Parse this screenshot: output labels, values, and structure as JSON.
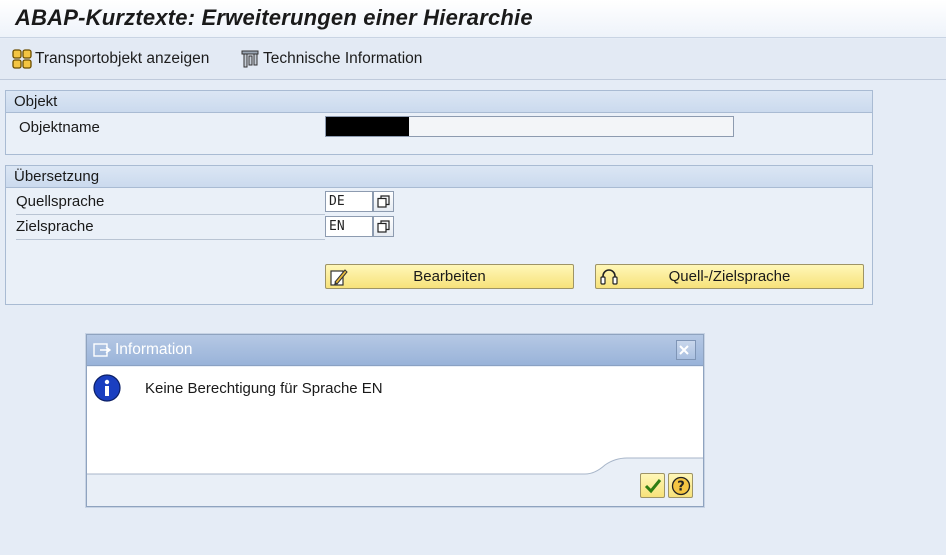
{
  "window": {
    "title": "ABAP-Kurztexte: Erweiterungen einer Hierarchie"
  },
  "toolbar": {
    "transport_label": "Transportobjekt anzeigen",
    "techinfo_label": "Technische Information"
  },
  "objekt": {
    "header": "Objekt",
    "objektname_label": "Objektname",
    "objektname_value": ""
  },
  "uebersetzung": {
    "header": "Übersetzung",
    "quellsprache_label": "Quellsprache",
    "quellsprache_value": "DE",
    "zielsprache_label": "Zielsprache",
    "zielsprache_value": "EN",
    "bearbeiten_label": "Bearbeiten",
    "quellziel_label": "Quell-/Zielsprache"
  },
  "dialog": {
    "title": "Information",
    "message": "Keine Berechtigung für Sprache EN"
  },
  "colors": {
    "accent_header": "#cbdaee",
    "button_yellow": "#f7e27a",
    "dialog_title": "#99b3d9"
  }
}
